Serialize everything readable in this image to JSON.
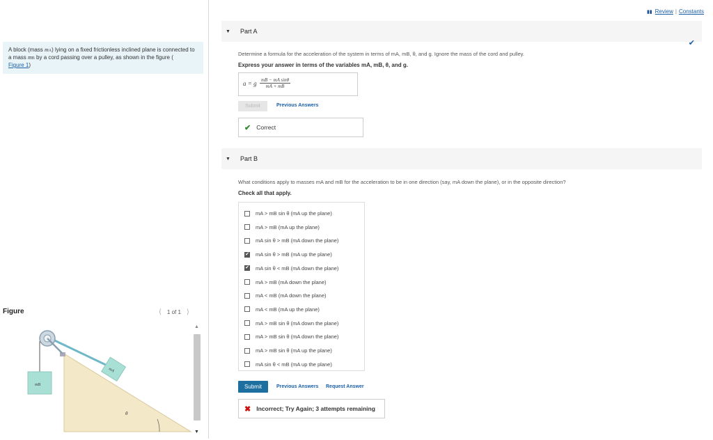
{
  "problem": {
    "text_before": "A block (mass ",
    "m_a": "m",
    "m_a_sub": "A",
    "text_mid": ") lying on a fixed frictionless inclined plane is connected to a mass ",
    "m_b": "m",
    "m_b_sub": "B",
    "text_after": " by a cord passing over a pulley, as shown in the figure (",
    "figure_link": "Figure 1",
    "text_end": ")"
  },
  "figure": {
    "label": "Figure",
    "pager": "1 of 1",
    "label_mb": "mB",
    "label_ma": "mA",
    "label_theta": "θ"
  },
  "topbar": {
    "review": "Review",
    "separator": "|",
    "constants": "Constants"
  },
  "partA": {
    "title": "Part A",
    "question": "Determine a formula for the acceleration of the system in terms of mA, mB, θ, and g. Ignore the mass of the cord and pulley.",
    "instruction": "Express your answer in terms of the variables mA, mB, θ, and g.",
    "eq_lhs": "a =",
    "eq_g": "g",
    "eq_num": "mB − mA sinθ",
    "eq_den": "mA + mB",
    "submit_label": "Submit",
    "previous_answers": "Previous Answers",
    "feedback": "Correct"
  },
  "partB": {
    "title": "Part B",
    "question": "What conditions apply to masses mA and mB for the acceleration to be in one direction (say, mA down the plane), or in the opposite direction?",
    "instruction": "Check all that apply.",
    "options": [
      {
        "label": "mA > mB sin θ (mA up the plane)",
        "checked": false
      },
      {
        "label": "mA > mB (mA up the plane)",
        "checked": false
      },
      {
        "label": "mA sin θ > mB (mA down the plane)",
        "checked": false
      },
      {
        "label": "mA sin θ > mB (mA up the plane)",
        "checked": true
      },
      {
        "label": "mA sin θ < mB (mA down the plane)",
        "checked": true
      },
      {
        "label": "mA > mB (mA down the plane)",
        "checked": false
      },
      {
        "label": "mA < mB (mA down the plane)",
        "checked": false
      },
      {
        "label": "mA < mB (mA up the plane)",
        "checked": false
      },
      {
        "label": "mA > mB sin θ (mA down the plane)",
        "checked": false
      },
      {
        "label": "mA > mB sin θ (mA down the plane)",
        "checked": false
      },
      {
        "label": "mA > mB sin θ (mA up the plane)",
        "checked": false
      },
      {
        "label": "mA sin θ < mB (mA up the plane)",
        "checked": false
      }
    ],
    "submit_label": "Submit",
    "previous_answers": "Previous Answers",
    "request_answer": "Request Answer",
    "feedback": "Incorrect; Try Again; 3 attempts remaining"
  },
  "colors": {
    "accent": "#1a5fa8",
    "submit_bg": "#1d6fa0",
    "correct": "#2e8b2e",
    "incorrect": "#cc1111",
    "problem_bg": "#e8f4f8"
  }
}
